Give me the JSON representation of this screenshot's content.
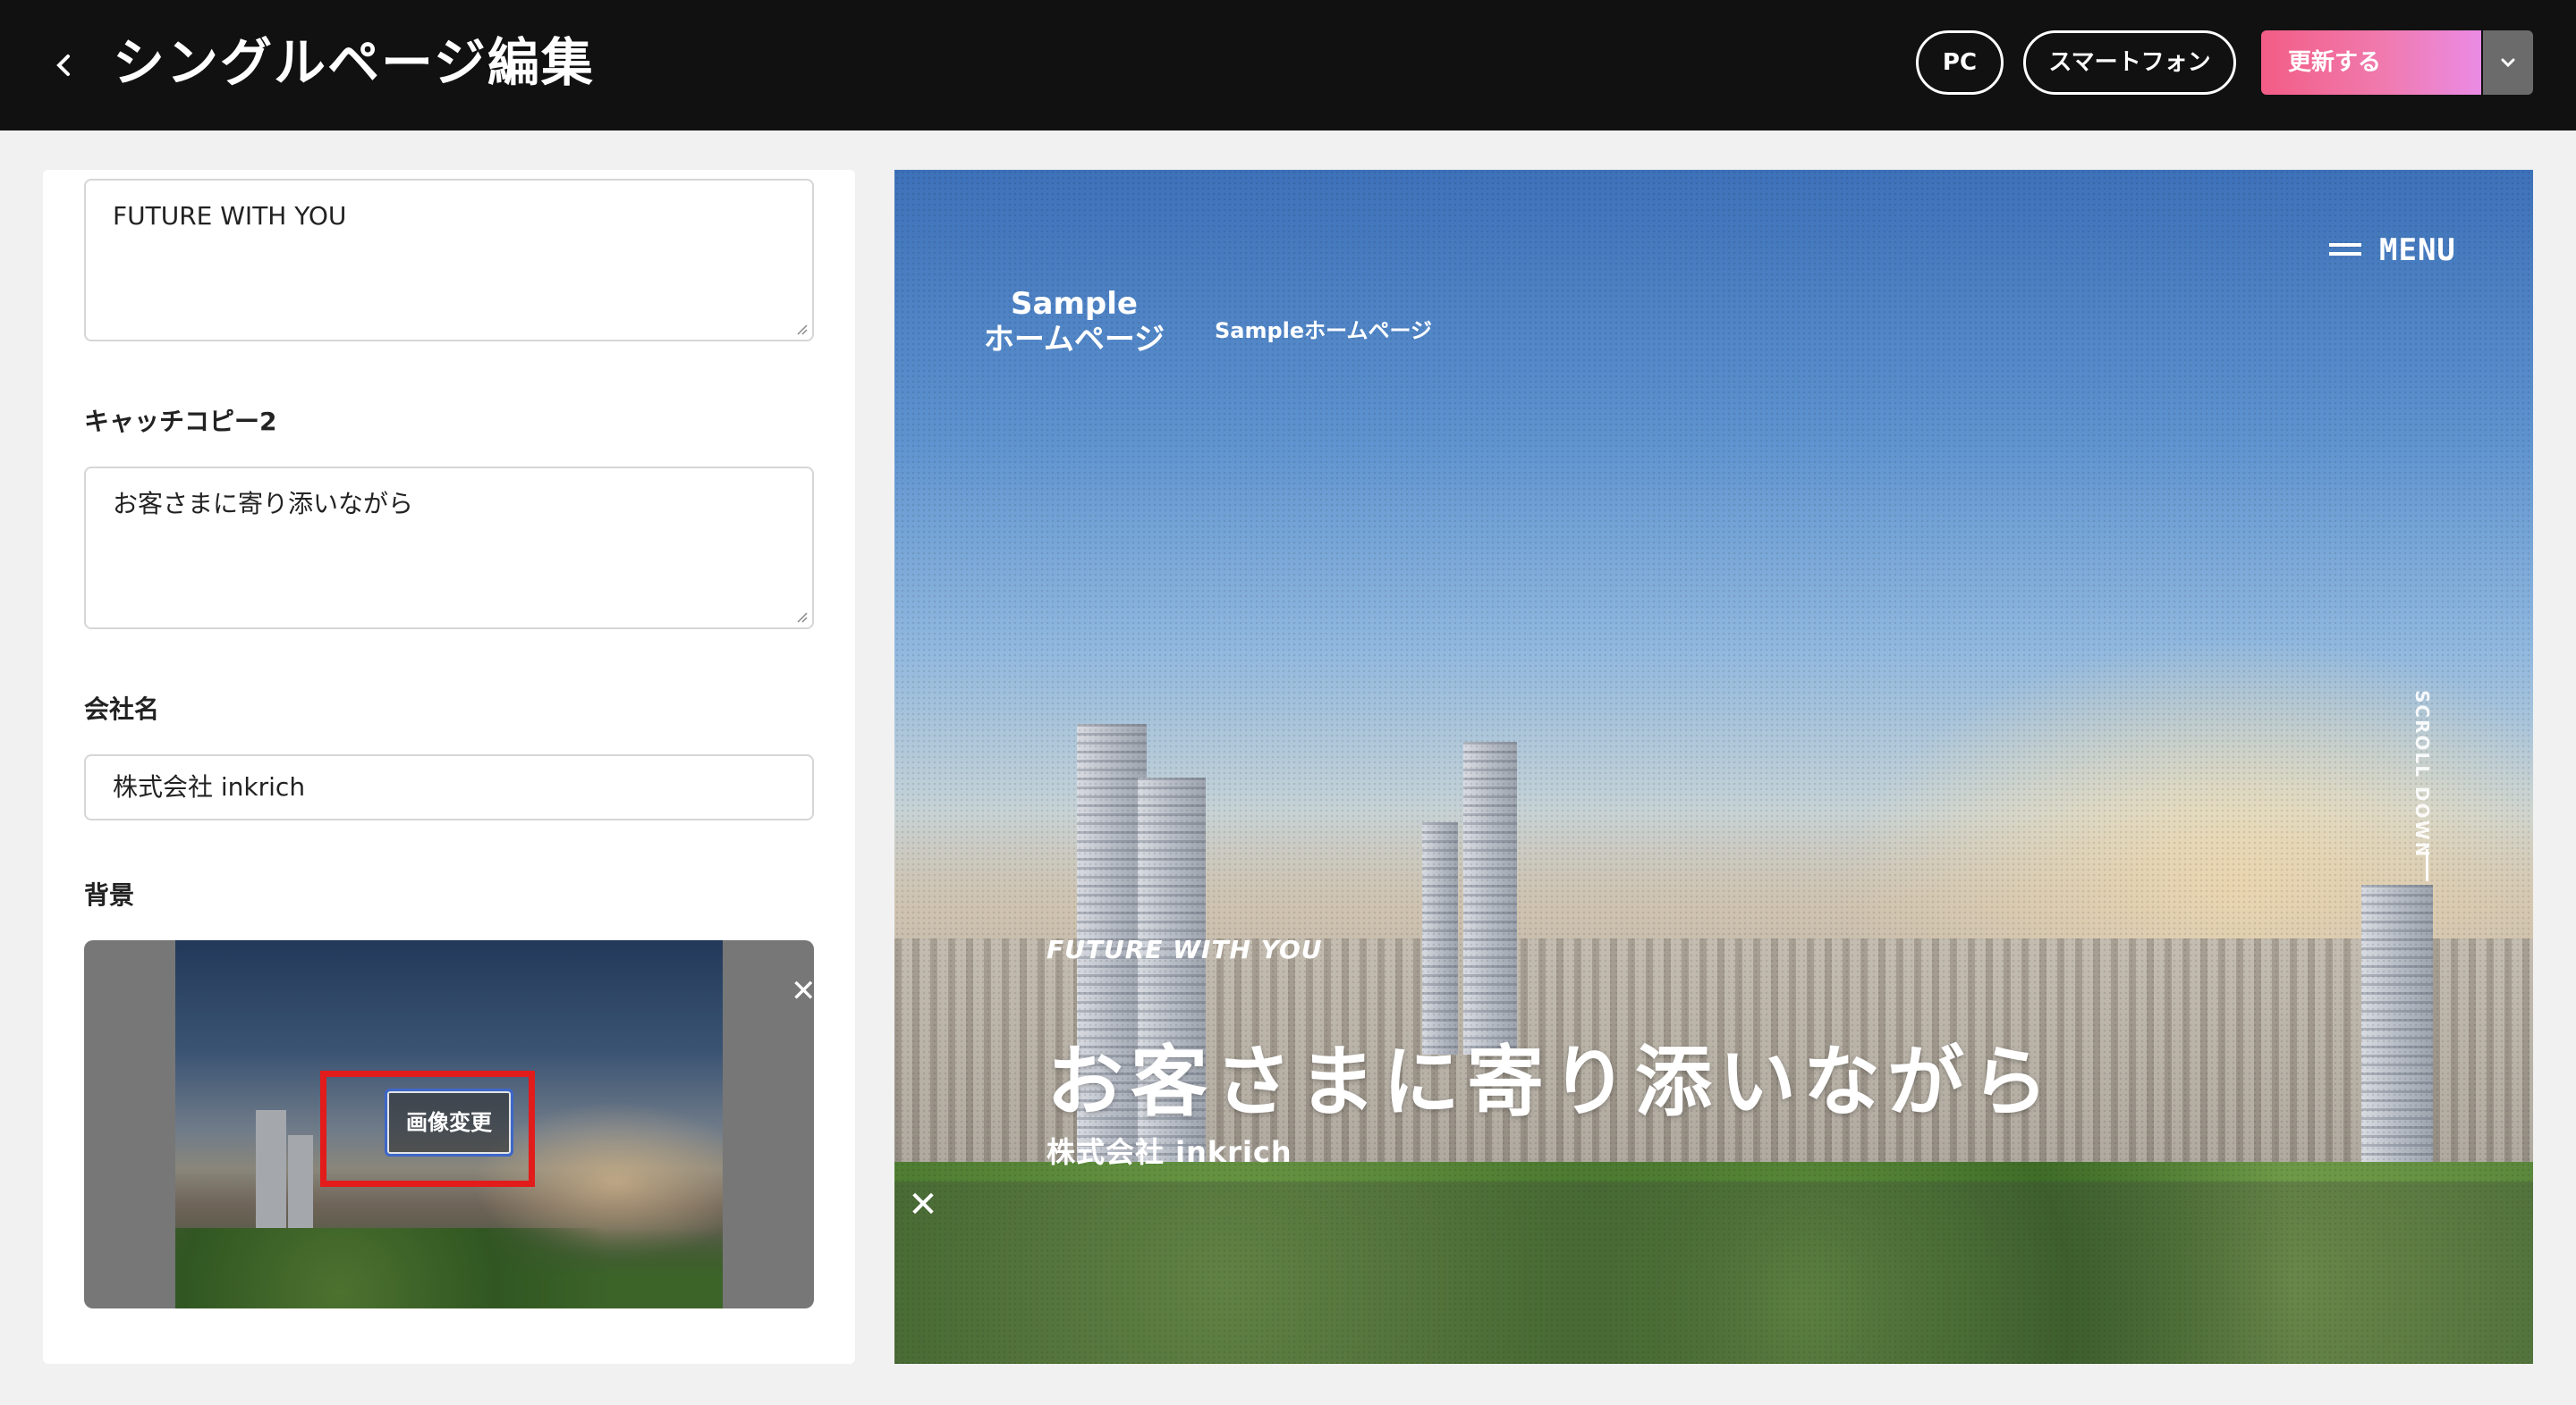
{
  "header": {
    "back_icon": "chevron-left-icon",
    "title": "シングルページ編集",
    "view_pc": "PC",
    "view_smartphone": "スマートフォン",
    "update_label": "更新する",
    "update_menu_icon": "chevron-down-icon",
    "accent_gradient": [
      "#f25d86",
      "#ea8be4"
    ]
  },
  "form": {
    "catch1_value": "FUTURE WITH YOU",
    "catch2_label": "キャッチコピー2",
    "catch2_value": "お客さまに寄り添いながら",
    "company_label": "会社名",
    "company_value": "株式会社 inkrich",
    "background_label": "背景",
    "change_image_label": "画像変更",
    "remove_icon": "close-icon"
  },
  "preview": {
    "logo_line1": "Sample",
    "logo_line2": "ホームページ",
    "site_name": "Sampleホームページ",
    "menu_label": "MENU",
    "scroll_label": "SCROLL DOWN",
    "subtitle": "FUTURE WITH YOU",
    "main_copy": "お客さまに寄り添いながら",
    "company": "株式会社 inkrich",
    "close_icon": "close-icon"
  }
}
